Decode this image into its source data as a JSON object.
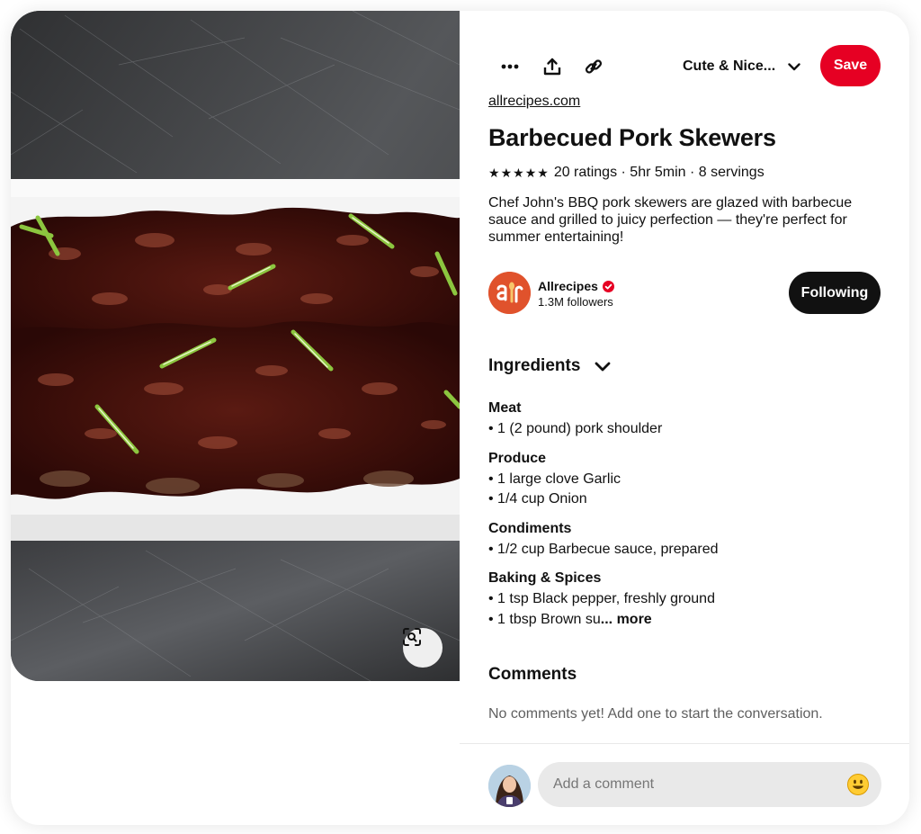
{
  "toolbar": {
    "more_icon": "ellipsis-icon",
    "share_icon": "share-upload-icon",
    "link_icon": "link-icon",
    "board_name": "Cute & Nice...",
    "save_label": "Save"
  },
  "pin": {
    "source": "allrecipes.com",
    "title": "Barbecued Pork Skewers",
    "rating_stars": 5,
    "ratings_text": "20 ratings",
    "time_text": "5hr 5min",
    "servings_text": "8 servings",
    "separator": " · ",
    "description": "Chef John's BBQ pork skewers are glazed with barbecue sauce and grilled to juicy perfection — they're perfect for summer entertaining!"
  },
  "creator": {
    "logo_text": "ar",
    "name": "Allrecipes",
    "followers": "1.3M followers",
    "follow_label": "Following"
  },
  "ingredients": {
    "title": "Ingredients",
    "groups": [
      {
        "title": "Meat",
        "items": [
          "• 1 (2 pound) pork shoulder"
        ]
      },
      {
        "title": "Produce",
        "items": [
          "• 1 large clove Garlic",
          "• 1/4 cup Onion"
        ]
      },
      {
        "title": "Condiments",
        "items": [
          "• 1/2 cup Barbecue sauce, prepared"
        ]
      },
      {
        "title": "Baking & Spices",
        "items": [
          "• 1 tsp Black pepper, freshly ground",
          "• 1 tbsp Brown su"
        ]
      }
    ],
    "more_label": "... more"
  },
  "comments": {
    "title": "Comments",
    "empty_text": "No comments yet! Add one to start the conversation.",
    "placeholder": "Add a comment"
  },
  "colors": {
    "save_red": "#e60023",
    "follow_black": "#111111",
    "verified_red": "#e60023",
    "input_gray": "#e9e9e9"
  }
}
